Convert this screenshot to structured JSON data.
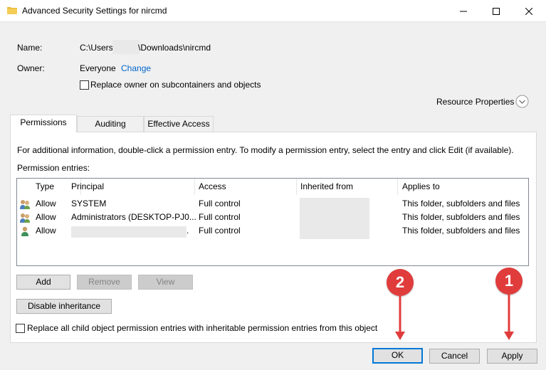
{
  "window": {
    "title": "Advanced Security Settings for nircmd"
  },
  "info": {
    "name_label": "Name:",
    "name_prefix": "C:\\Users\\",
    "name_suffix": "\\Downloads\\nircmd",
    "owner_label": "Owner:",
    "owner_value": "Everyone",
    "change_link": "Change",
    "replace_owner_label": "Replace owner on subcontainers and objects",
    "resource_properties": "Resource Properties"
  },
  "tabs": [
    {
      "label": "Permissions",
      "active": true
    },
    {
      "label": "Auditing",
      "active": false
    },
    {
      "label": "Effective Access",
      "active": false
    }
  ],
  "permissions": {
    "info_text": "For additional information, double-click a permission entry. To modify a permission entry, select the entry and click Edit (if available).",
    "entries_label": "Permission entries:",
    "columns": [
      "Type",
      "Principal",
      "Access",
      "Inherited from",
      "Applies to"
    ],
    "rows": [
      {
        "type": "Allow",
        "principal": "SYSTEM",
        "access": "Full control",
        "inherited": "",
        "applies": "This folder, subfolders and files",
        "icon": "group-icon"
      },
      {
        "type": "Allow",
        "principal": "Administrators (DESKTOP-PJ0...",
        "access": "Full control",
        "inherited": "",
        "applies": "This folder, subfolders and files",
        "icon": "group-icon"
      },
      {
        "type": "Allow",
        "principal": ".",
        "access": "Full control",
        "inherited": "",
        "applies": "This folder, subfolders and files",
        "icon": "user-icon"
      }
    ]
  },
  "buttons": {
    "add": "Add",
    "remove": "Remove",
    "view": "View",
    "disable_inheritance": "Disable inheritance",
    "replace_child_label": "Replace all child object permission entries with inheritable permission entries from this object",
    "ok": "OK",
    "cancel": "Cancel",
    "apply": "Apply"
  },
  "annotations": {
    "badge_1": "1",
    "badge_2": "2",
    "color": "#e03c3c"
  }
}
